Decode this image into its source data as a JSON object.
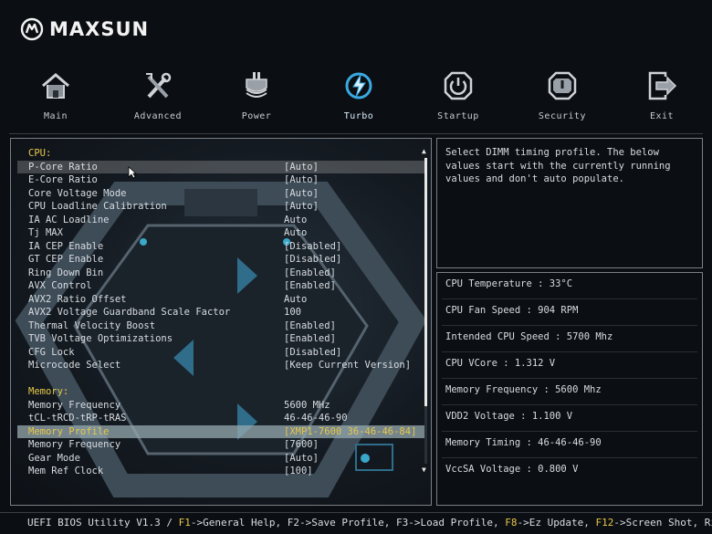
{
  "brand": {
    "name": "MAXSUN"
  },
  "nav": [
    {
      "label": "Main",
      "icon": "home-icon"
    },
    {
      "label": "Advanced",
      "icon": "tools-icon"
    },
    {
      "label": "Power",
      "icon": "power-plug-icon"
    },
    {
      "label": "Turbo",
      "icon": "turbo-icon",
      "active": true
    },
    {
      "label": "Startup",
      "icon": "startup-power-icon"
    },
    {
      "label": "Security",
      "icon": "security-shield-icon"
    },
    {
      "label": "Exit",
      "icon": "exit-icon"
    }
  ],
  "settings": [
    {
      "name": "CPU:",
      "value": "",
      "section": true
    },
    {
      "name": "P-Core Ratio",
      "value": "[Auto]",
      "hover": true
    },
    {
      "name": "E-Core Ratio",
      "value": "[Auto]"
    },
    {
      "name": "Core Voltage Mode",
      "value": "[Auto]"
    },
    {
      "name": "CPU Loadline Calibration",
      "value": "[Auto]"
    },
    {
      "name": "IA AC Loadline",
      "value": "Auto"
    },
    {
      "name": "Tj MAX",
      "value": "Auto"
    },
    {
      "name": "IA CEP Enable",
      "value": "[Disabled]"
    },
    {
      "name": "GT CEP Enable",
      "value": "[Disabled]"
    },
    {
      "name": "Ring Down Bin",
      "value": "[Enabled]"
    },
    {
      "name": "AVX Control",
      "value": "[Enabled]"
    },
    {
      "name": "AVX2 Ratio Offset",
      "value": "Auto"
    },
    {
      "name": "AVX2 Voltage Guardband Scale Factor",
      "value": "100"
    },
    {
      "name": "Thermal Velocity Boost",
      "value": "[Enabled]"
    },
    {
      "name": "TVB Voltage Optimizations",
      "value": "[Enabled]"
    },
    {
      "name": "CFG Lock",
      "value": "[Disabled]"
    },
    {
      "name": "Microcode Select",
      "value": "[Keep Current Version]"
    },
    {
      "name": "",
      "value": ""
    },
    {
      "name": "Memory:",
      "value": "",
      "section": true
    },
    {
      "name": "Memory Frequency",
      "value": " 5600 MHz"
    },
    {
      "name": "tCL-tRCD-tRP-tRAS",
      "value": "46-46-46-90"
    },
    {
      "name": "Memory Profile",
      "value": "[XMP1-7600 36-46-46-84]",
      "selected": true
    },
    {
      "name": "Memory Frequency",
      "value": "[7600]"
    },
    {
      "name": "Gear Mode",
      "value": "[Auto]"
    },
    {
      "name": "Mem Ref Clock",
      "value": "[100]"
    }
  ],
  "help": {
    "text": "Select DIMM timing profile. The below values start with the currently running values and don't auto populate."
  },
  "status": [
    {
      "text": "CPU Temperature : 33°C"
    },
    {
      "text": "CPU Fan Speed : 904 RPM"
    },
    {
      "text": "Intended CPU Speed : 5700 Mhz"
    },
    {
      "text": "CPU VCore : 1.312 V"
    },
    {
      "text": "Memory Frequency : 5600 Mhz"
    },
    {
      "text": "VDD2 Voltage : 1.100 V"
    },
    {
      "text": "Memory Timing : 46-46-46-90"
    },
    {
      "text": "VccSA Voltage : 0.800 V"
    }
  ],
  "footer": {
    "parts": [
      {
        "t": "UEFI BIOS Utility V1.3 / ",
        "key": false
      },
      {
        "t": "F1",
        "key": true
      },
      {
        "t": "->General Help, F2->Save Profile, F3->Load Profile, ",
        "key": false
      },
      {
        "t": "F8",
        "key": true
      },
      {
        "t": "->Ez Update, ",
        "key": false
      },
      {
        "t": "F12",
        "key": true
      },
      {
        "t": "->Screen Shot, Right",
        "key": false
      }
    ]
  },
  "colors": {
    "accent": "#e8c84a",
    "turbo": "#3aa8e0",
    "border": "#7a8088"
  }
}
